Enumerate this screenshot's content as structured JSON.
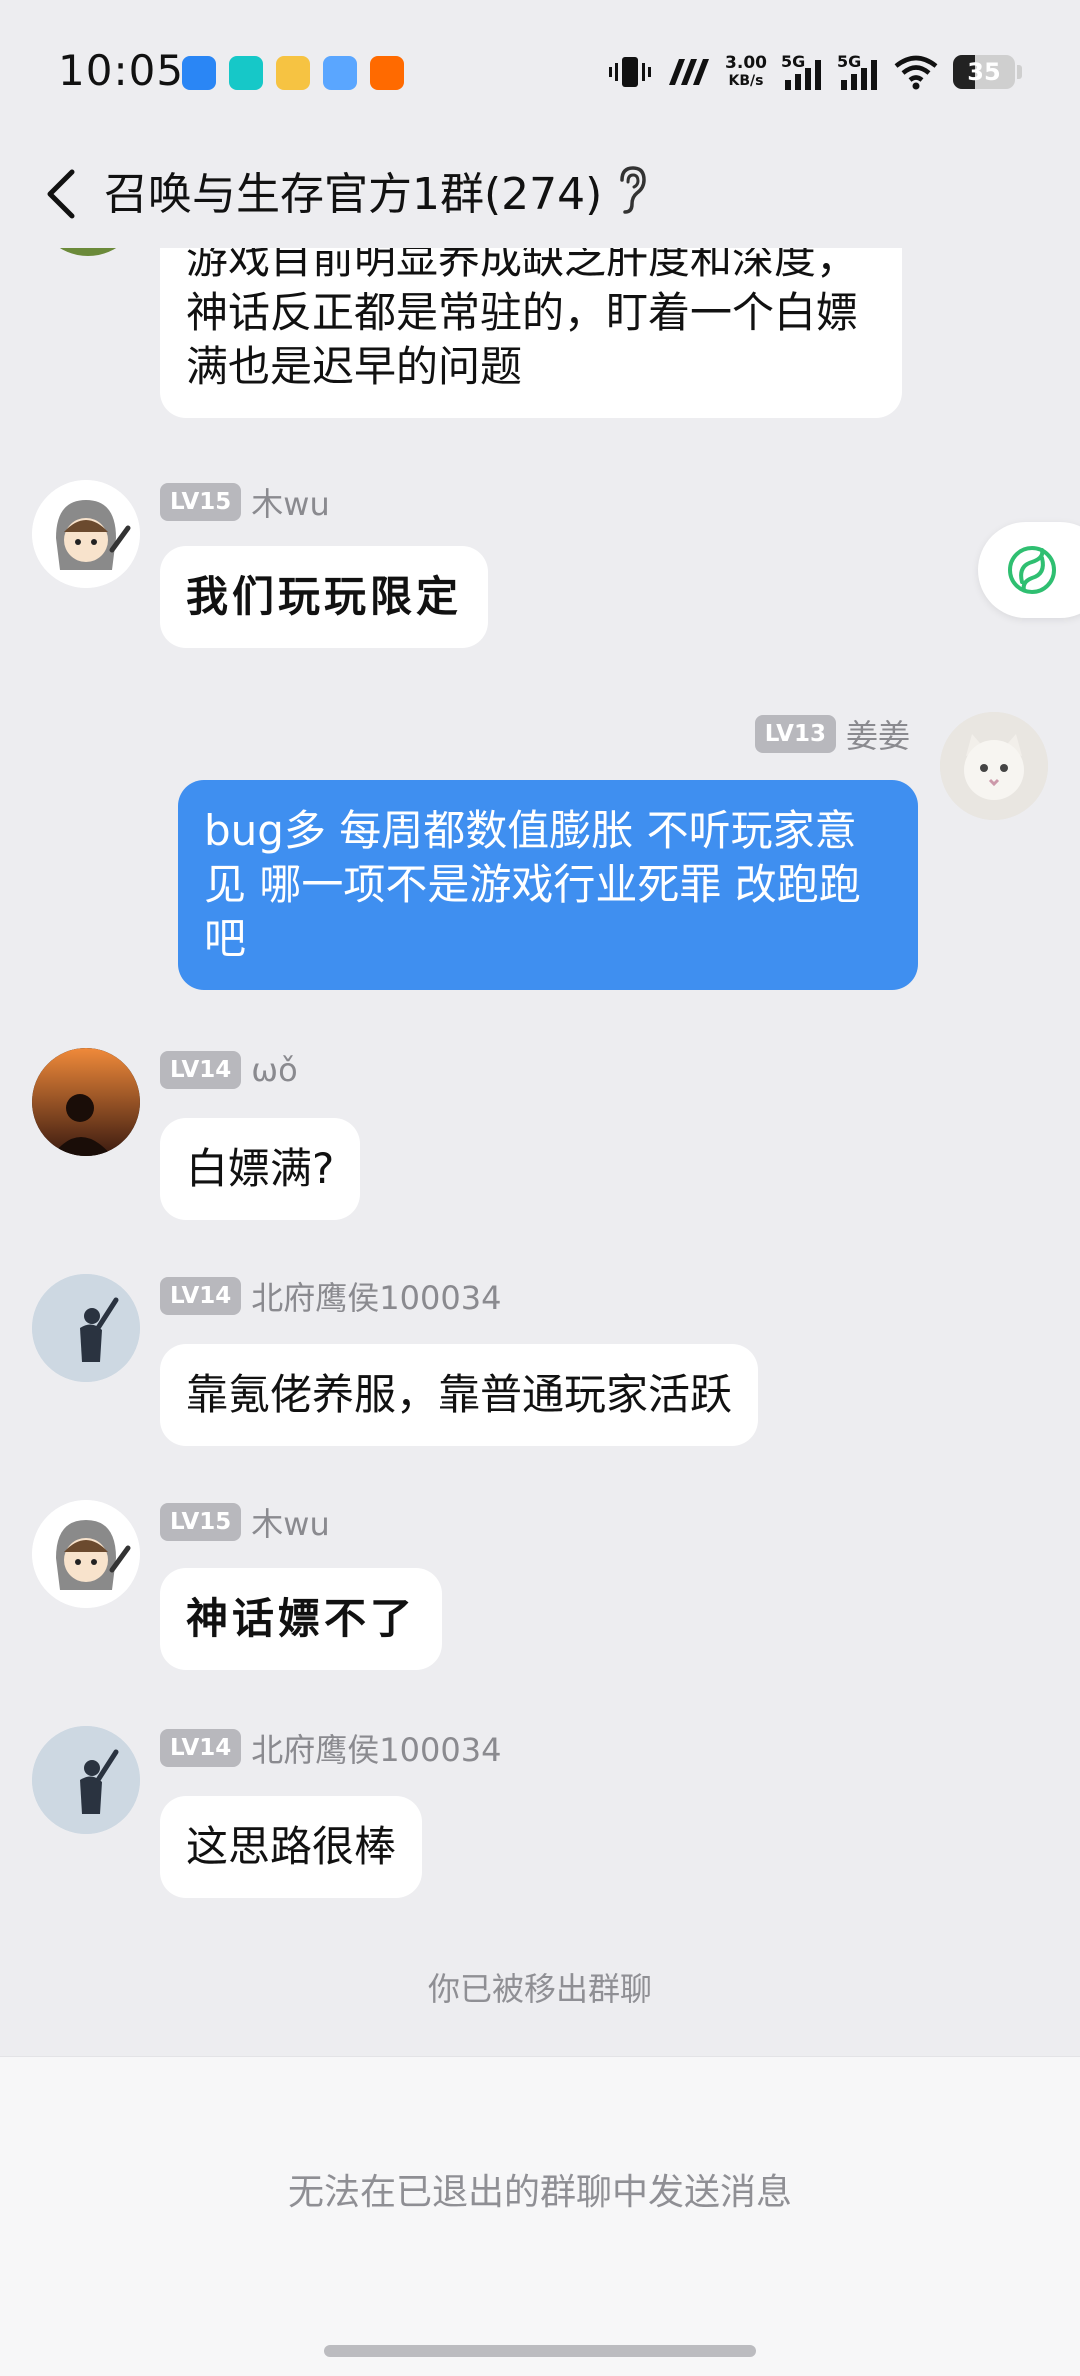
{
  "status_bar": {
    "time": "10:05",
    "speed_value": "3.00",
    "speed_unit": "KB/s",
    "net1": "5G",
    "net2": "5G",
    "battery": "35"
  },
  "header": {
    "title": "召唤与生存官方1群(274)"
  },
  "messages": [
    {
      "text": "游戏目前明显养成缺乏肝度和深度，神话反正都是常驻的，盯着一个白嫖满也是迟早的问题"
    },
    {
      "level": "LV15",
      "name": "木wu",
      "text": "我们玩玩限定"
    },
    {
      "level": "LV13",
      "name": "姜姜",
      "text": "bug多 每周都数值膨胀 不听玩家意见 哪一项不是游戏行业死罪 改跑跑吧"
    },
    {
      "level": "LV14",
      "name": "ωǒ",
      "text": "白嫖满?"
    },
    {
      "level": "LV14",
      "name": "北府鹰侯100034",
      "text": "靠氪佬养服，靠普通玩家活跃"
    },
    {
      "level": "LV15",
      "name": "木wu",
      "text": "神话嫖不了"
    },
    {
      "level": "LV14",
      "name": "北府鹰侯100034",
      "text": "这思路很棒"
    }
  ],
  "system_notice": "你已被移出群聊",
  "input_disabled_text": "无法在已退出的群聊中发送消息",
  "colors": {
    "self_bubble": "#3f8ff0",
    "background": "#ededf0",
    "level_badge": "#b8b8bd"
  }
}
